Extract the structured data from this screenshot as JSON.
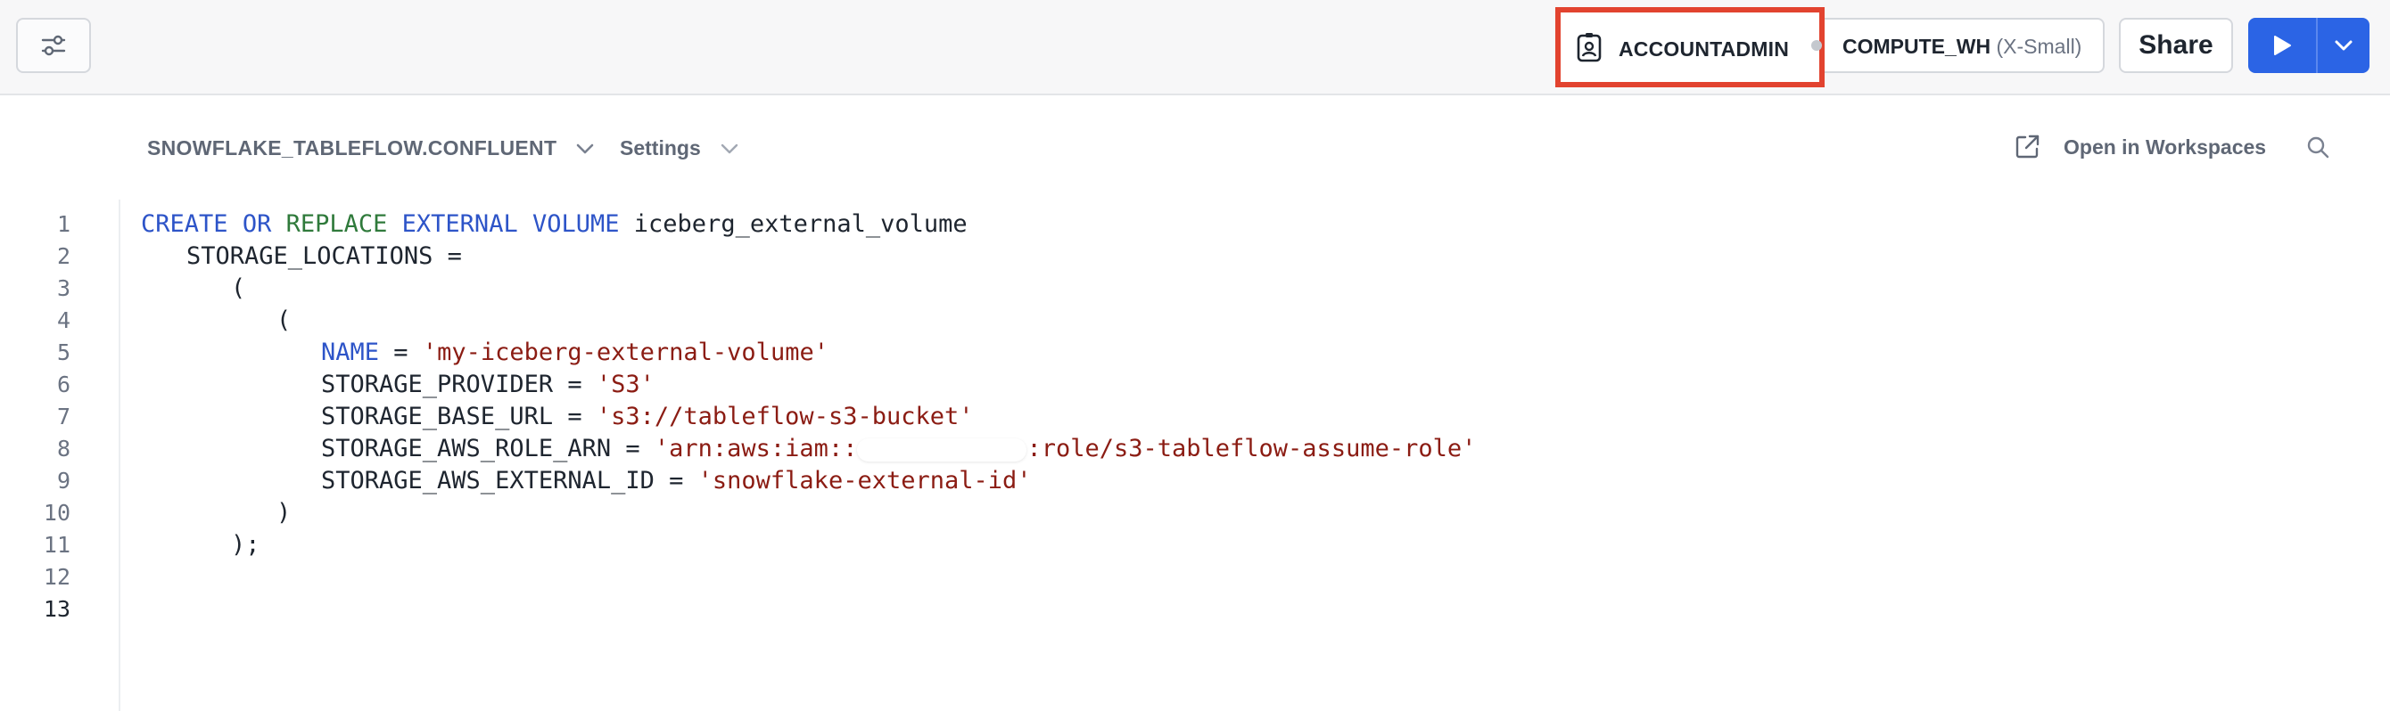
{
  "toolbar": {
    "filter_icon": "sliders-icon",
    "role": "ACCOUNTADMIN",
    "role_icon": "id-badge-icon",
    "warehouse": "COMPUTE_WH",
    "warehouse_size": "(X-Small)",
    "share_label": "Share",
    "run_icon": "play-icon",
    "run_menu_icon": "chevron-down-icon",
    "highlight_color": "#e2432f",
    "accent_color": "#2b64e5"
  },
  "editor_header": {
    "context": "SNOWFLAKE_TABLEFLOW.CONFLUENT",
    "settings": "Settings",
    "open_in_workspaces": "Open in Workspaces",
    "search_icon": "search-icon"
  },
  "editor": {
    "line_numbers": [
      "1",
      "2",
      "3",
      "4",
      "5",
      "6",
      "7",
      "8",
      "9",
      "10",
      "11",
      "12",
      "13"
    ],
    "active_line": "13",
    "lines": {
      "l1_kw1": "CREATE",
      "l1_kw2": "OR",
      "l1_kw3": "REPLACE",
      "l1_kw4": "EXTERNAL",
      "l1_kw5": "VOLUME",
      "l1_rest": "iceberg_external_volume",
      "l2": "STORAGE_LOCATIONS =",
      "l3": "(",
      "l4": "(",
      "l5_kw": "NAME",
      "l5_eq": " = ",
      "l5_str": "'my-iceberg-external-volume'",
      "l6_key": "STORAGE_PROVIDER = ",
      "l6_str": "'S3'",
      "l7_key": "STORAGE_BASE_URL = ",
      "l7_str": "'s3://tableflow-s3-bucket'",
      "l8_key": "STORAGE_AWS_ROLE_ARN = ",
      "l8_str_a": "'arn:aws:iam::",
      "l8_str_b": ":role/s3-tableflow-assume-role'",
      "l9_key": "STORAGE_AWS_EXTERNAL_ID = ",
      "l9_str": "'snowflake-external-id'",
      "l10": ")",
      "l11": ");"
    }
  }
}
